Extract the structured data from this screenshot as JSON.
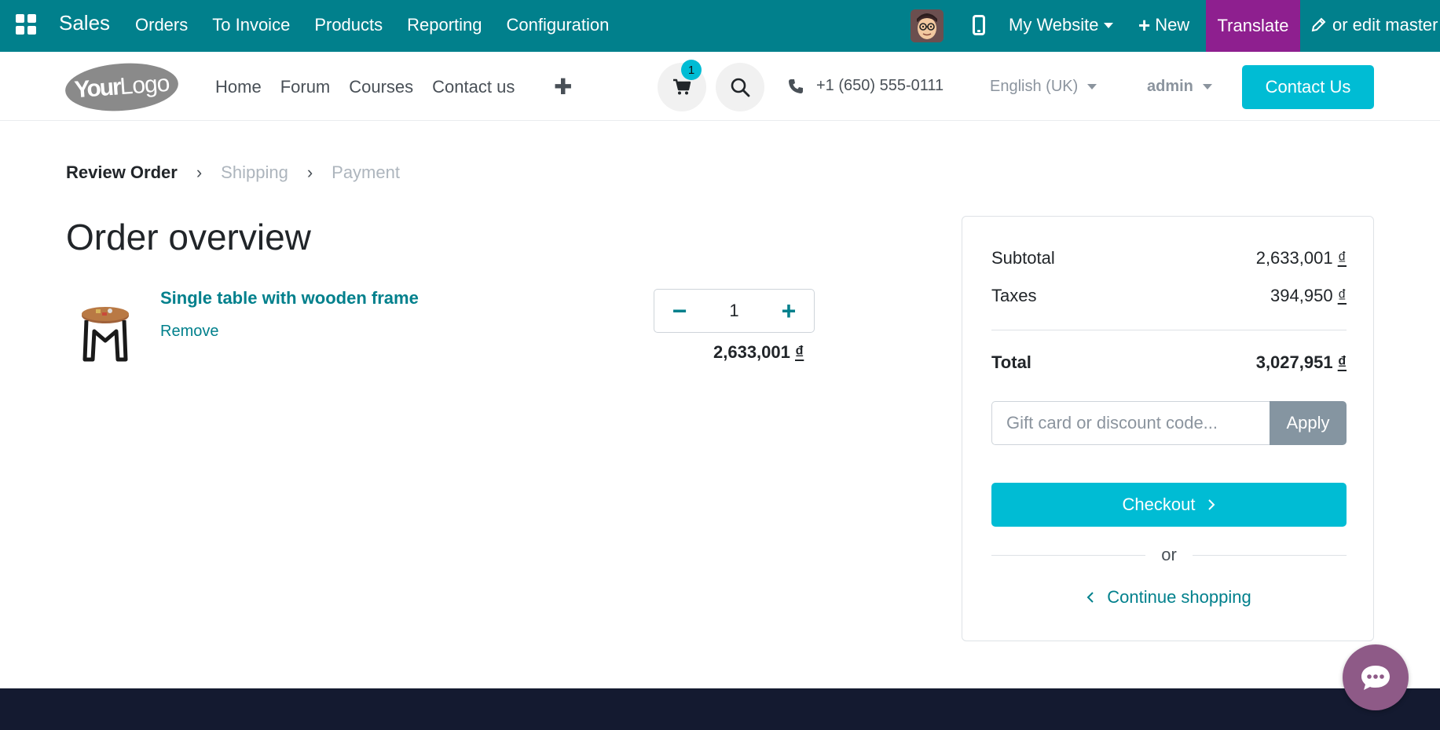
{
  "admin_bar": {
    "app_name": "Sales",
    "menu": [
      "Orders",
      "To Invoice",
      "Products",
      "Reporting",
      "Configuration"
    ],
    "website_label": "My Website",
    "new_label": "New",
    "translate_label": "Translate",
    "edit_label": "or edit master",
    "colors": {
      "bar": "#01808c",
      "translate": "#8e1f8f"
    }
  },
  "header": {
    "logo_bold": "Your",
    "logo_light": "Logo",
    "nav": [
      "Home",
      "Forum",
      "Courses",
      "Contact us"
    ],
    "cart_count": "1",
    "phone": "+1 (650) 555-0111",
    "language": "English (UK)",
    "user": "admin",
    "contact_button": "Contact Us"
  },
  "steps": {
    "current": "Review Order",
    "next": [
      "Shipping",
      "Payment"
    ]
  },
  "order": {
    "title": "Order overview",
    "product_name": "Single table with wooden frame",
    "remove_label": "Remove",
    "quantity": "1",
    "price_amount": "2,633,001",
    "currency": "₫"
  },
  "summary": {
    "subtotal_label": "Subtotal",
    "subtotal_amount": "2,633,001",
    "taxes_label": "Taxes",
    "taxes_amount": "394,950",
    "total_label": "Total",
    "total_amount": "3,027,951",
    "currency": "₫",
    "promo_placeholder": "Gift card or discount code...",
    "apply_label": "Apply",
    "checkout_label": "Checkout",
    "or_label": "or",
    "continue_label": "Continue shopping"
  }
}
